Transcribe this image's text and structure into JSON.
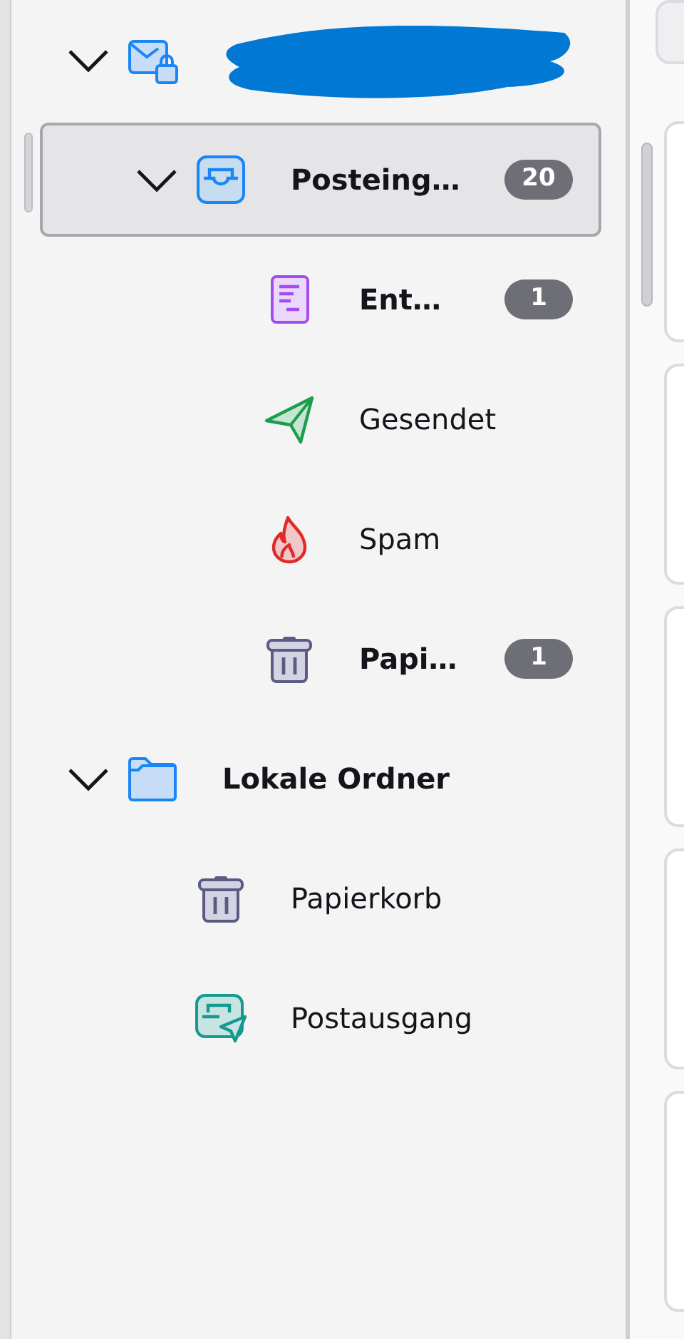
{
  "folder_tree": [
    {
      "kind": "account",
      "name_redacted": true,
      "expanded": true,
      "selected": false,
      "children": [
        {
          "kind": "inbox",
          "name": "Posteing…",
          "expanded": true,
          "selected": true,
          "bold": true,
          "unread": "20",
          "children": [
            {
              "kind": "drafts",
              "name": "Ent…",
              "selected": false,
              "bold": true,
              "unread": "1"
            },
            {
              "kind": "sent",
              "name": "Gesendet",
              "selected": false,
              "bold": false
            },
            {
              "kind": "junk",
              "name": "Spam",
              "selected": false,
              "bold": false
            },
            {
              "kind": "trash",
              "name": "Papi…",
              "selected": false,
              "bold": true,
              "unread": "1"
            }
          ]
        }
      ]
    },
    {
      "kind": "folder",
      "name": "Lokale Ordner",
      "expanded": true,
      "selected": false,
      "bold": true,
      "children": [
        {
          "kind": "trash",
          "name": "Papierkorb",
          "selected": false,
          "bold": false
        },
        {
          "kind": "outbox",
          "name": "Postausgang",
          "selected": false,
          "bold": false
        }
      ]
    }
  ]
}
